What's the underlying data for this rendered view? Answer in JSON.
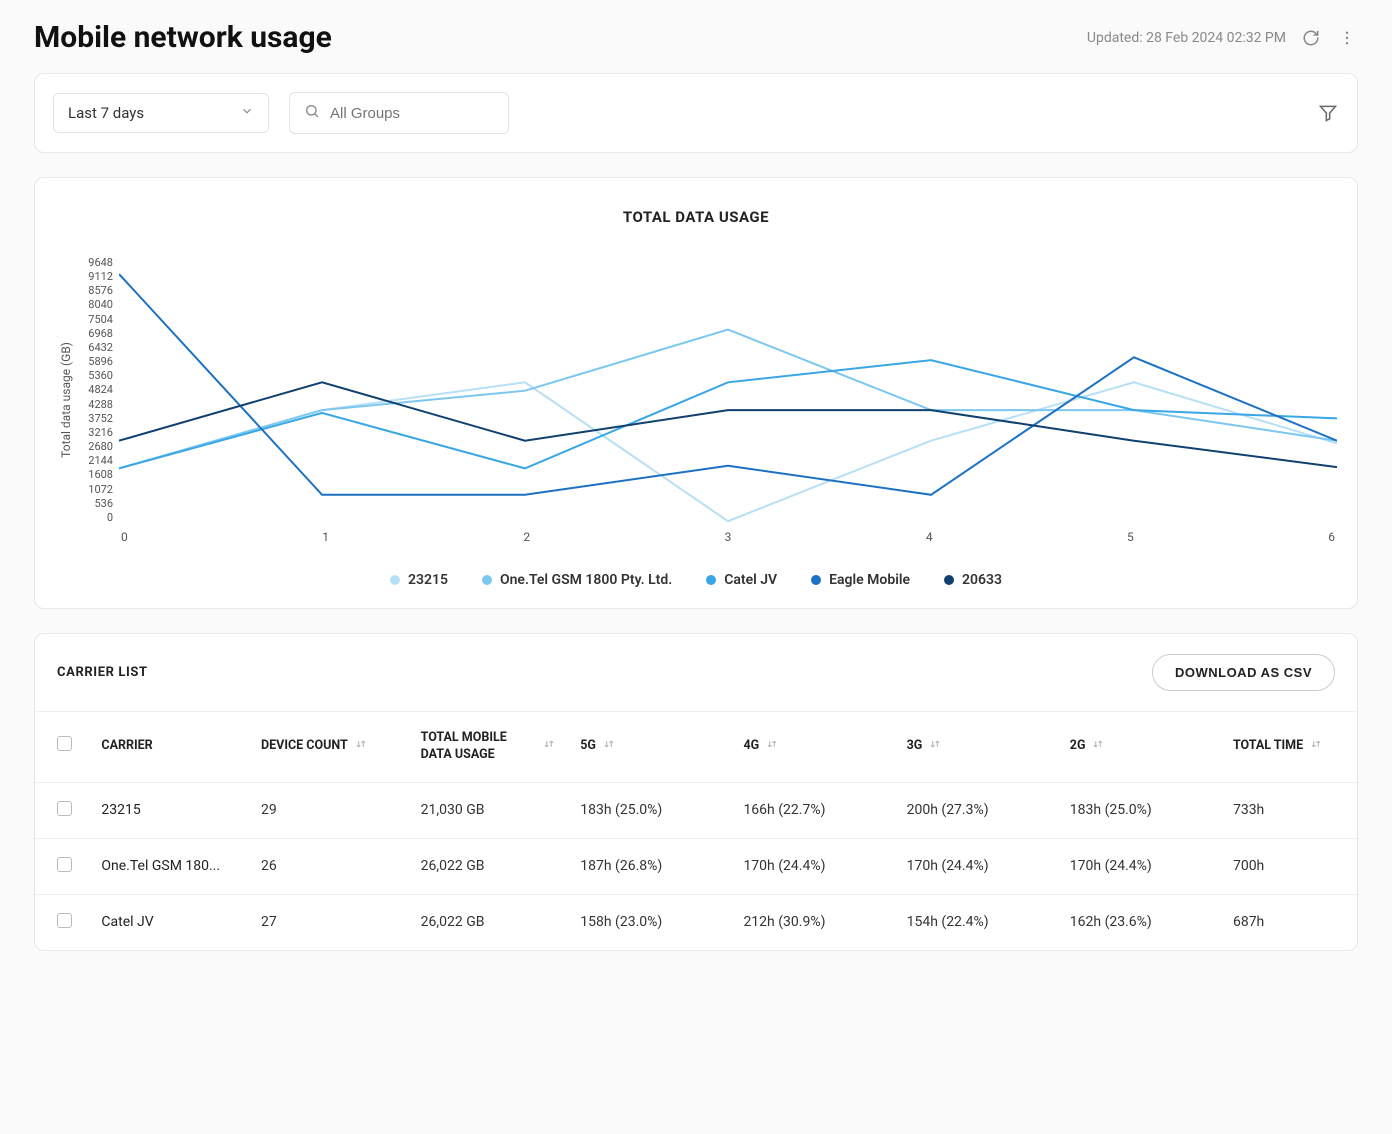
{
  "header": {
    "title": "Mobile network usage",
    "updated_prefix": "Updated: ",
    "updated_value": "28 Feb 2024 02:32 PM"
  },
  "filters": {
    "range": "Last 7 days",
    "search_placeholder": "All Groups"
  },
  "chart_data": {
    "type": "line",
    "title": "TOTAL DATA USAGE",
    "ylabel": "Total data usage (GB)",
    "xlabel": "",
    "x": [
      0,
      1,
      2,
      3,
      4,
      5,
      6
    ],
    "y_ticks": [
      9648,
      9112,
      8576,
      8040,
      7504,
      6968,
      6432,
      5896,
      5360,
      4824,
      4288,
      3752,
      3216,
      2680,
      2144,
      1608,
      1072,
      536,
      0
    ],
    "ylim": [
      0,
      9648
    ],
    "series": [
      {
        "name": "23215",
        "color": "#b7dff5",
        "values": [
          2000,
          4100,
          5100,
          100,
          3000,
          5100,
          2900
        ]
      },
      {
        "name": "One.Tel GSM 1800 Pty. Ltd.",
        "color": "#7cc7ef",
        "values": [
          2000,
          4100,
          4800,
          7000,
          4100,
          4100,
          3000
        ]
      },
      {
        "name": "Catel JV",
        "color": "#39a6e5",
        "values": [
          2000,
          4000,
          2000,
          5100,
          5900,
          4100,
          3800
        ]
      },
      {
        "name": "Eagle Mobile",
        "color": "#1c71c4",
        "values": [
          9000,
          1050,
          1050,
          2100,
          1050,
          6000,
          3000
        ]
      },
      {
        "name": "20633",
        "color": "#10406e",
        "values": [
          3000,
          5100,
          3000,
          4100,
          4100,
          3000,
          2050
        ]
      }
    ]
  },
  "carrier_list": {
    "title": "CARRIER LIST",
    "download_label": "DOWNLOAD AS CSV",
    "columns": {
      "carrier": "CARRIER",
      "device_count": "DEVICE COUNT",
      "total": "TOTAL MOBILE DATA USAGE",
      "g5": "5G",
      "g4": "4G",
      "g3": "3G",
      "g2": "2G",
      "total_time": "TOTAL TIME"
    },
    "rows": [
      {
        "carrier": "23215",
        "device_count": "29",
        "total": "21,030 GB",
        "g5": "183h (25.0%)",
        "g4": "166h (22.7%)",
        "g3": "200h (27.3%)",
        "g2": "183h (25.0%)",
        "total_time": "733h"
      },
      {
        "carrier": "One.Tel GSM 180...",
        "device_count": "26",
        "total": "26,022 GB",
        "g5": "187h (26.8%)",
        "g4": "170h (24.4%)",
        "g3": "170h (24.4%)",
        "g2": "170h (24.4%)",
        "total_time": "700h"
      },
      {
        "carrier": "Catel JV",
        "device_count": "27",
        "total": "26,022 GB",
        "g5": "158h (23.0%)",
        "g4": "212h (30.9%)",
        "g3": "154h (22.4%)",
        "g2": "162h (23.6%)",
        "total_time": "687h"
      }
    ]
  }
}
